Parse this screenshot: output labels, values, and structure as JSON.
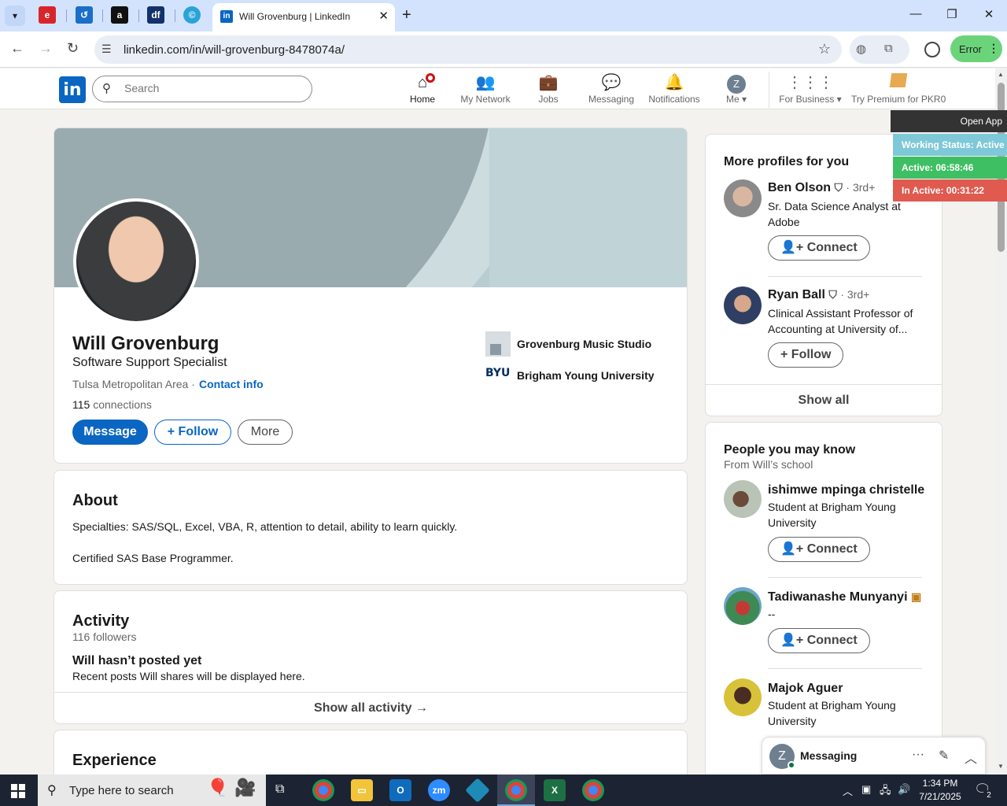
{
  "browser": {
    "active_tab_title": "Will Grovenburg | LinkedIn",
    "url": "linkedin.com/in/will-grovenburg-8478074a/",
    "profile_status": "Error"
  },
  "nav": {
    "search_placeholder": "Search",
    "items": {
      "home": "Home",
      "network": "My Network",
      "jobs": "Jobs",
      "messaging": "Messaging",
      "notifications": "Notifications",
      "me": "Me",
      "business": "For Business",
      "premium": "Try Premium for PKR0"
    },
    "me_initial": "Z"
  },
  "overlay": {
    "open_app": "Open App",
    "working_status": "Working Status: Active",
    "active": "Active: 06:58:46",
    "inactive": "In Active: 00:31:22",
    "colors": {
      "working": "#7ec8d8",
      "active": "#3fbf63",
      "inactive": "#e05a4f"
    }
  },
  "profile": {
    "name": "Will Grovenburg",
    "headline": "Software Support Specialist",
    "location": "Tulsa Metropolitan Area · ",
    "contact_info": "Contact info",
    "connections_count": "115",
    "connections_label": " connections",
    "buttons": {
      "message": "Message",
      "follow": "+ Follow",
      "more": "More"
    },
    "current_company": "Grovenburg Music Studio",
    "education_logo": "BYU",
    "education": "Brigham Young University"
  },
  "about": {
    "title": "About",
    "line1": "Specialties: SAS/SQL, Excel, VBA, R, attention to detail, ability to learn quickly.",
    "line2": "Certified SAS Base Programmer."
  },
  "activity": {
    "title": "Activity",
    "followers": "116 followers",
    "empty_title": "Will hasn’t posted yet",
    "empty_sub": "Recent posts Will shares will be displayed here.",
    "show_all": "Show all activity →"
  },
  "experience": {
    "title": "Experience"
  },
  "more_profiles": {
    "title": "More profiles for you",
    "people": [
      {
        "name": "Ben Olson",
        "degree": "· 3rd+",
        "subtitle": "Sr. Data Science Analyst at Adobe",
        "action": "Connect"
      },
      {
        "name": "Ryan Ball",
        "degree": "· 3rd+",
        "subtitle": "Clinical Assistant Professor of Accounting at University of...",
        "action": "+ Follow"
      }
    ],
    "show_all": "Show all"
  },
  "people_you_may_know": {
    "title": "People you may know",
    "subtitle": "From Will’s school",
    "people": [
      {
        "name": "ishimwe mpinga christelle",
        "subtitle": "Student at Brigham Young University",
        "action": "Connect"
      },
      {
        "name": "Tadiwanashe Munyanyi",
        "subtitle": "--",
        "action": "Connect"
      },
      {
        "name": "Majok Aguer",
        "subtitle": "Student at Brigham Young University"
      }
    ]
  },
  "messaging_panel": {
    "title": "Messaging",
    "initial": "Z"
  },
  "taskbar": {
    "search_placeholder": "Type here to search",
    "time": "1:34 PM",
    "date": "7/21/2025",
    "notification_count": "2"
  }
}
